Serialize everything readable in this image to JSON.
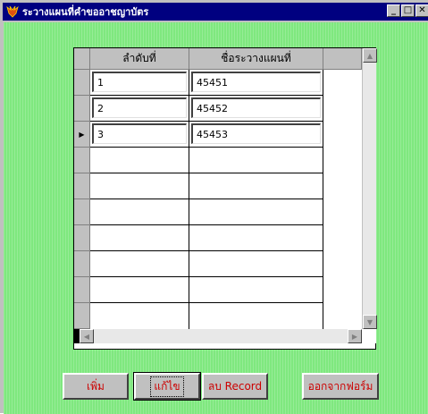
{
  "window": {
    "title": "ระวางแผนที่คำขออาชญาบัตร",
    "title_color": "#000080"
  },
  "colors": {
    "background": "#7fe87f",
    "button_text": "#cc0000"
  },
  "grid": {
    "columns": [
      "ลำดับที่",
      "ชื่อระวางแผนที่"
    ],
    "rows": [
      {
        "seq": "1",
        "name": "45451"
      },
      {
        "seq": "2",
        "name": "45452"
      },
      {
        "seq": "3",
        "name": "45453"
      }
    ],
    "current_row_indicator": "▶"
  },
  "buttons": {
    "add": "เพิ่ม",
    "edit": "แก้ไข",
    "delete": "ลบ Record",
    "exit": "ออกจากฟอร์ม"
  }
}
